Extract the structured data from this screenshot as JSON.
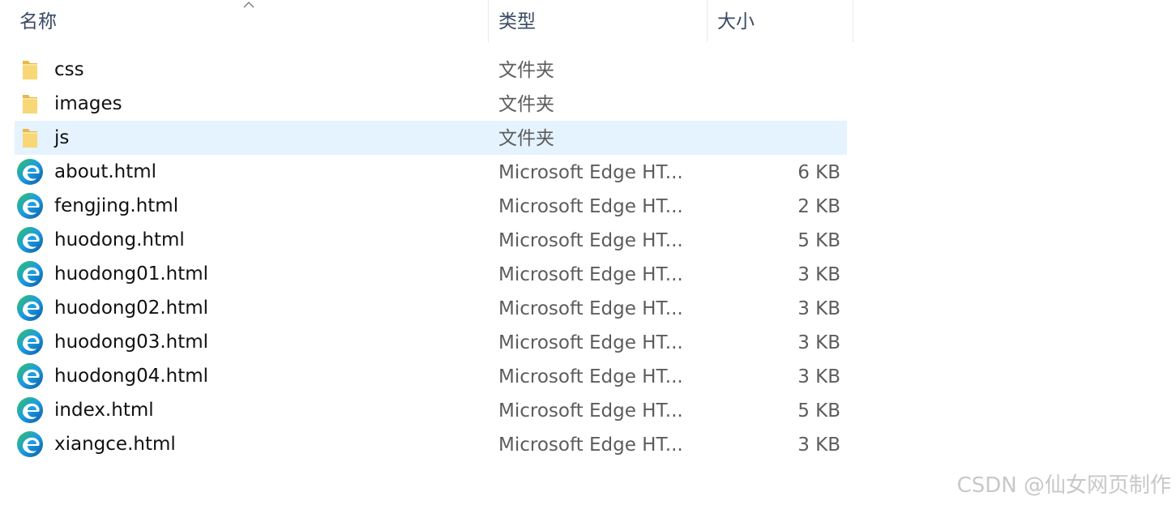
{
  "columns": {
    "name": "名称",
    "type": "类型",
    "size": "大小"
  },
  "sort": {
    "column": "name",
    "direction": "ascending",
    "icon": "sort-up-arrow-icon"
  },
  "files": [
    {
      "name": "css",
      "type": "文件夹",
      "size": "",
      "icon": "folder-icon",
      "selected": false
    },
    {
      "name": "images",
      "type": "文件夹",
      "size": "",
      "icon": "folder-icon",
      "selected": false
    },
    {
      "name": "js",
      "type": "文件夹",
      "size": "",
      "icon": "folder-icon",
      "selected": true
    },
    {
      "name": "about.html",
      "type": "Microsoft Edge HT...",
      "size": "6 KB",
      "icon": "edge-icon",
      "selected": false
    },
    {
      "name": "fengjing.html",
      "type": "Microsoft Edge HT...",
      "size": "2 KB",
      "icon": "edge-icon",
      "selected": false
    },
    {
      "name": "huodong.html",
      "type": "Microsoft Edge HT...",
      "size": "5 KB",
      "icon": "edge-icon",
      "selected": false
    },
    {
      "name": "huodong01.html",
      "type": "Microsoft Edge HT...",
      "size": "3 KB",
      "icon": "edge-icon",
      "selected": false
    },
    {
      "name": "huodong02.html",
      "type": "Microsoft Edge HT...",
      "size": "3 KB",
      "icon": "edge-icon",
      "selected": false
    },
    {
      "name": "huodong03.html",
      "type": "Microsoft Edge HT...",
      "size": "3 KB",
      "icon": "edge-icon",
      "selected": false
    },
    {
      "name": "huodong04.html",
      "type": "Microsoft Edge HT...",
      "size": "3 KB",
      "icon": "edge-icon",
      "selected": false
    },
    {
      "name": "index.html",
      "type": "Microsoft Edge HT...",
      "size": "5 KB",
      "icon": "edge-icon",
      "selected": false
    },
    {
      "name": "xiangce.html",
      "type": "Microsoft Edge HT...",
      "size": "3 KB",
      "icon": "edge-icon",
      "selected": false
    }
  ],
  "watermark": "CSDN @仙女网页制作",
  "colors": {
    "selection": "#e5f3ff",
    "header_text": "#3a4a63",
    "folder": "#f8d775",
    "edge_blue": "#0c59a4",
    "edge_green": "#35c15d"
  }
}
